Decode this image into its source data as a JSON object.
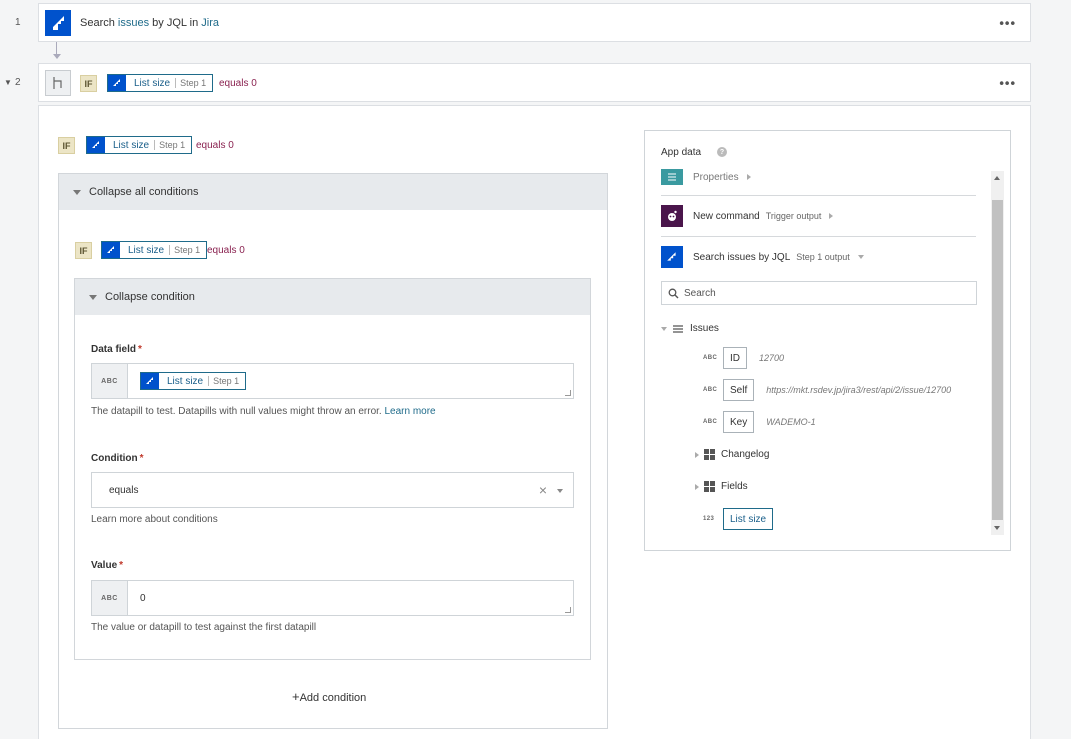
{
  "steps": [
    {
      "number": "1",
      "prefix": "Search ",
      "obj": "issues",
      "mid": " by JQL in ",
      "app": "Jira",
      "menu": "•••"
    },
    {
      "number": "2",
      "badge": "IF",
      "pill": {
        "name": "List size",
        "step": "Step 1"
      },
      "condition": "equals 0",
      "menu": "•••"
    }
  ],
  "condition_header": {
    "badge": "IF",
    "pill": {
      "name": "List size",
      "step": "Step 1"
    },
    "condition": "equals 0"
  },
  "collapse_all": "Collapse all conditions",
  "inner_header": {
    "badge": "IF",
    "pill": {
      "name": "List size",
      "step": "Step 1"
    },
    "condition": "equals 0"
  },
  "collapse_condition": "Collapse condition",
  "data_field": {
    "label": "Data field",
    "required": "*",
    "type": "ABC",
    "pill": {
      "name": "List size",
      "step": "Step 1"
    },
    "help": "The datapill to test. Datapills with null values might throw an error. ",
    "help_link": "Learn more"
  },
  "condition": {
    "label": "Condition",
    "required": "*",
    "value": "equals",
    "link": "Learn more about conditions"
  },
  "value_field": {
    "label": "Value",
    "required": "*",
    "type": "ABC",
    "value": "0",
    "help": "The value or datapill to test against the first datapill"
  },
  "add_condition": "Add condition",
  "app_data": {
    "title": "App data",
    "properties": "Properties",
    "trigger": {
      "name": "New command",
      "sub": "Trigger output"
    },
    "step1": {
      "name": "Search issues by JQL",
      "sub": "Step 1 output"
    },
    "search_placeholder": "Search",
    "tree": {
      "root": "Issues",
      "items": [
        {
          "type": "ABC",
          "name": "ID",
          "value": "12700"
        },
        {
          "type": "ABC",
          "name": "Self",
          "value": "https://mkt.rsdev.jp/jira3/rest/api/2/issue/12700"
        },
        {
          "type": "ABC",
          "name": "Key",
          "value": "WADEMO-1"
        }
      ],
      "changelog": "Changelog",
      "fields": "Fields",
      "list_size": {
        "type": "123",
        "name": "List size"
      }
    }
  },
  "colors": {
    "jira": "#0052cc",
    "link": "#1f6b8a",
    "keyword": "#8a2250",
    "required": "#c0392b"
  }
}
